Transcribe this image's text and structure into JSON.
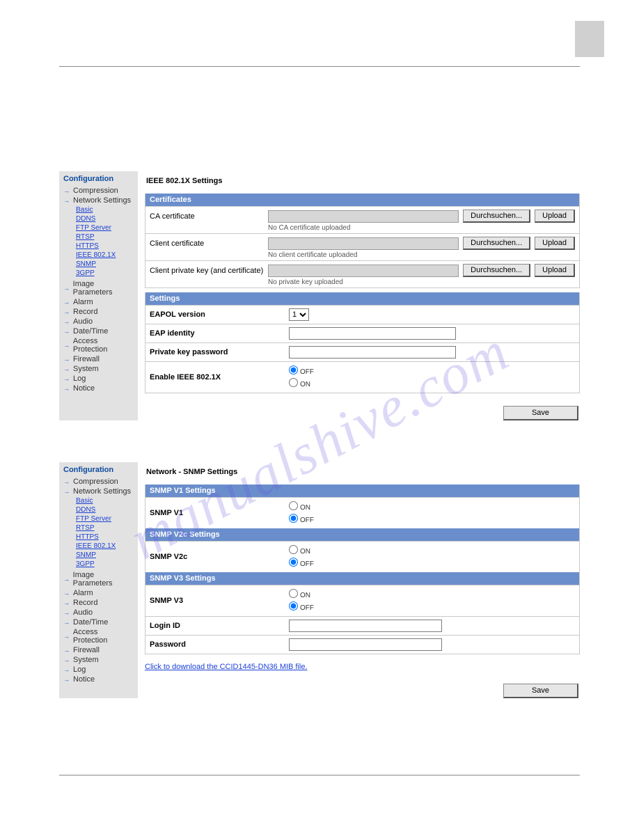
{
  "watermark": "manualshive.com",
  "sidebar": {
    "title": "Configuration",
    "items": [
      {
        "label": "Compression"
      },
      {
        "label": "Network Settings"
      },
      {
        "label": "Image Parameters"
      },
      {
        "label": "Alarm"
      },
      {
        "label": "Record"
      },
      {
        "label": "Audio"
      },
      {
        "label": "Date/Time"
      },
      {
        "label": "Access Protection"
      },
      {
        "label": "Firewall"
      },
      {
        "label": "System"
      },
      {
        "label": "Log"
      },
      {
        "label": "Notice"
      }
    ],
    "network_subitems": [
      {
        "label": "Basic"
      },
      {
        "label": "DDNS"
      },
      {
        "label": "FTP Server"
      },
      {
        "label": "RTSP"
      },
      {
        "label": "HTTPS"
      },
      {
        "label": "IEEE 802.1X"
      },
      {
        "label": "SNMP"
      },
      {
        "label": "3GPP"
      }
    ]
  },
  "ieee": {
    "title": "IEEE 802.1X Settings",
    "certificates_header": "Certificates",
    "settings_header": "Settings",
    "browse_label": "Durchsuchen...",
    "upload_label": "Upload",
    "rows": [
      {
        "label": "CA certificate",
        "status": "No CA certificate uploaded"
      },
      {
        "label": "Client certificate",
        "status": "No client certificate uploaded"
      },
      {
        "label": "Client private key (and certificate)",
        "status": "No private key uploaded"
      }
    ],
    "eapol_label": "EAPOL version",
    "eapol_value": "1",
    "eap_identity_label": "EAP identity",
    "pk_password_label": "Private key password",
    "enable_label": "Enable IEEE 802.1X",
    "off_label": "OFF",
    "on_label": "ON",
    "save_label": "Save"
  },
  "snmp": {
    "title": "Network - SNMP Settings",
    "v1_header": "SNMP V1 Settings",
    "v1_label": "SNMP V1",
    "v2c_header": "SNMP V2c Settings",
    "v2c_label": "SNMP V2c",
    "v3_header": "SNMP V3 Settings",
    "v3_label": "SNMP V3",
    "on_label": "ON",
    "off_label": "OFF",
    "login_label": "Login ID",
    "password_label": "Password",
    "download_link": "Click to download the CCID1445-DN36 MIB file.",
    "save_label": "Save"
  }
}
